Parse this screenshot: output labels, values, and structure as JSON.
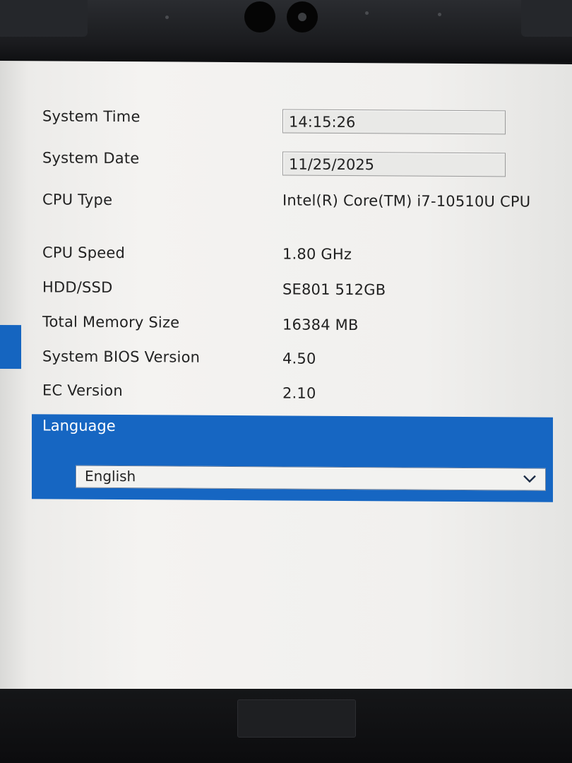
{
  "settings": [
    {
      "label": "System Time",
      "value": "14:15:26"
    },
    {
      "label": "System Date",
      "value": "11/25/2025"
    },
    {
      "label": "CPU Type",
      "value": "Intel(R) Core(TM) i7-10510U CPU"
    },
    {
      "label": "CPU Speed",
      "value": "1.80 GHz"
    },
    {
      "label": "HDD/SSD",
      "value": "SE801 512GB"
    },
    {
      "label": "Total Memory Size",
      "value": "16384 MB"
    },
    {
      "label": "System BIOS Version",
      "value": "4.50"
    },
    {
      "label": "EC Version",
      "value": "2.10"
    }
  ],
  "language": {
    "label": "Language",
    "selected": "English",
    "icon": "chevron-down-icon"
  },
  "colors": {
    "accent": "#1666c2",
    "background": "#f1f0ee",
    "text": "#222222"
  }
}
